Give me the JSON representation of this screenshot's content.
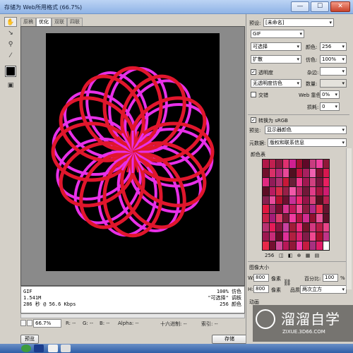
{
  "window": {
    "title": "存储为 Web所用格式 (66.7%)",
    "btn_min": "—",
    "btn_max": "☐",
    "btn_close": "✕"
  },
  "tabs": [
    "原稿",
    "优化",
    "双联",
    "四联"
  ],
  "active_tab_index": 1,
  "info": {
    "left_lines": [
      "GIF",
      "1.541M",
      "286 秒 @ 56.6 Kbps"
    ],
    "right_lines": [
      "100% 仿色",
      "\"可选择\" 调板",
      "256 颜色"
    ]
  },
  "bottom": {
    "zoom": "66.7%",
    "r": "R: --",
    "g": "G: --",
    "b": "B: --",
    "alpha": "Alpha: --",
    "hex": "十六进制: --",
    "index": "索引: --"
  },
  "buttons": {
    "preview": "预览",
    "save": "存储"
  },
  "settings": {
    "preset_label": "预设:",
    "preset_value": "[未命名]",
    "format": "GIF",
    "palette": "可选择",
    "colors_label": "颜色:",
    "colors_value": "256",
    "dither_algo": "扩散",
    "dither_label": "仿色:",
    "dither_value": "100%",
    "transparency_label": "透明度",
    "matte_label": "杂边:",
    "transparency_dither": "无透明度仿色",
    "amount_label": "数量:",
    "interlaced_label": "交错",
    "websnap_label": "Web 靠色:",
    "websnap_value": "0%",
    "lossy_label": "损耗:",
    "lossy_value": "0",
    "srgb_label": "转换为 sRGB",
    "preview_label": "预览:",
    "preview_value": "显示器颜色",
    "metadata_label": "元数据:",
    "metadata_value": "版权和联系信息",
    "color_table_label": "颜色表",
    "color_count": "256",
    "image_size_label": "图像大小",
    "w_label": "W:",
    "w_value": "800",
    "h_label": "H:",
    "h_value": "800",
    "unit": "像素",
    "percent_label": "百分比:",
    "percent_value": "100",
    "percent_unit": "%",
    "quality_label": "品质:",
    "quality_value": "两次立方",
    "animation_label": "动画"
  },
  "watermark": {
    "brand": "溜溜自学",
    "url": "ZIXUE.3D66.COM"
  },
  "colors": {
    "ring_red": "#e0162c",
    "ring_magenta": "#e830e8",
    "background": "#000000"
  },
  "palette_swatches": [
    "#b01848",
    "#c02050",
    "#8a1840",
    "#e03070",
    "#d02090",
    "#a01030",
    "#600828",
    "#c83c80",
    "#f040a0",
    "#901838",
    "#70102c",
    "#d83068",
    "#b82878",
    "#e84898",
    "#501020",
    "#c01040",
    "#a82060",
    "#f060b0",
    "#801030",
    "#d81850",
    "#e02880",
    "#901c58",
    "#b03070",
    "#c81838",
    "#682038",
    "#f03890",
    "#a01850",
    "#d04080",
    "#7c1440",
    "#e82060",
    "#5c0c24",
    "#b81c60",
    "#d82c48",
    "#982048",
    "#f058a8",
    "#c02868",
    "#701838",
    "#e03c88",
    "#a81440",
    "#d01c70",
    "#882050",
    "#e84c9c",
    "#b41030",
    "#6c1030",
    "#c83098",
    "#f02870",
    "#941448",
    "#d84078",
    "#581020",
    "#b82050",
    "#e01840",
    "#a02868",
    "#780c30",
    "#d83490",
    "#c01858",
    "#f04c98",
    "#8c1c40",
    "#b02888",
    "#e82c50",
    "#641430",
    "#c82048",
    "#a41c78",
    "#dc3c6c",
    "#7c1838",
    "#f03ca0",
    "#b01440",
    "#d02c90",
    "#901030",
    "#e85098",
    "#5c1028",
    "#b83070",
    "#e41c58",
    "#881440",
    "#c840a0",
    "#a01c38",
    "#f02c80",
    "#701428",
    "#d43880",
    "#b81c48",
    "#e84488",
    "#9c1850",
    "#c82c78",
    "#640c28",
    "#e03098",
    "#b02040",
    "#d82070",
    "#801c48",
    "#f04890",
    "#a81030",
    "#c03488",
    "#e82848",
    "#741030",
    "#d04898",
    "#b81858",
    "#901838",
    "#f038a8",
    "#c41c40",
    "#a83080",
    "#e01c68",
    "#ffffff"
  ]
}
